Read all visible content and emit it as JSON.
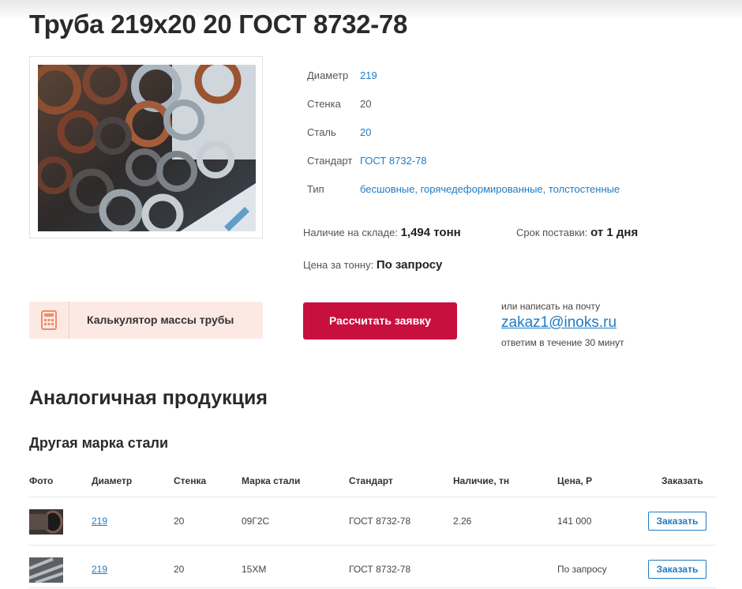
{
  "product": {
    "title": "Труба 219х20 20 ГОСТ 8732-78",
    "photo_icon": "pipe-stack-photo"
  },
  "specs": [
    {
      "label": "Диаметр",
      "value": "219",
      "link": true
    },
    {
      "label": "Стенка",
      "value": "20",
      "link": false
    },
    {
      "label": "Сталь",
      "value": "20",
      "link": true
    },
    {
      "label": "Стандарт",
      "value": "ГОСТ 8732-78",
      "link": true
    },
    {
      "label": "Тип",
      "value": "бесшовные, горячедеформированные, толстостенные",
      "link": true
    }
  ],
  "stock": {
    "label": "Наличие на складе:",
    "value": "1,494 тонн"
  },
  "delivery": {
    "label": "Срок поставки:",
    "value": "от 1 дня"
  },
  "price": {
    "label": "Цена за тонну:",
    "value": "По запросу"
  },
  "calculator": {
    "label": "Калькулятор массы трубы",
    "icon": "calculator-icon"
  },
  "order_button": {
    "label": "Рассчитать заявку"
  },
  "contact": {
    "note": "или написать на почту",
    "email": "zakaz1@inoks.ru",
    "response": "ответим в течение 30 минут"
  },
  "similar": {
    "heading": "Аналогичная продукция",
    "subheading": "Другая марка стали",
    "columns": [
      "Фото",
      "Диаметр",
      "Стенка",
      "Марка стали",
      "Стандарт",
      "Наличие, тн",
      "Цена, Р",
      "Заказать"
    ],
    "rows": [
      {
        "diameter": "219",
        "wall": "20",
        "grade": "09Г2С",
        "standard": "ГОСТ 8732-78",
        "stock": "2.26",
        "price": "141 000",
        "action": "Заказать"
      },
      {
        "diameter": "219",
        "wall": "20",
        "grade": "15ХМ",
        "standard": "ГОСТ 8732-78",
        "stock": "",
        "price": "По запросу",
        "action": "Заказать"
      }
    ]
  },
  "colors": {
    "accent": "#c8103e",
    "link": "#1f7bc4",
    "calc_bg": "#fde9e4"
  }
}
